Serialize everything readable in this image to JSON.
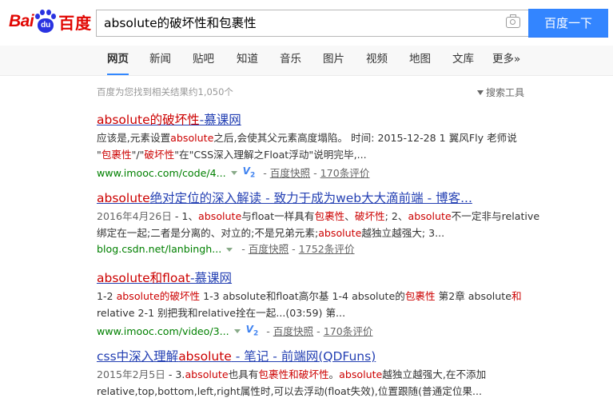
{
  "logo": {
    "left": "Bai",
    "mid": "du",
    "right": "百度"
  },
  "search": {
    "query": "absolute的破坏性和包裹性",
    "button": "百度一下"
  },
  "tabs": [
    "网页",
    "新闻",
    "贴吧",
    "知道",
    "音乐",
    "图片",
    "视频",
    "地图",
    "文库",
    "更多»"
  ],
  "stats": {
    "count": "百度为您找到相关结果约1,050个",
    "tools": "搜索工具"
  },
  "results": [
    {
      "title_parts": [
        "absolute的破坏性",
        "-慕课网"
      ],
      "abstract_lines": [
        [
          "应该是,元素设置",
          "absolute",
          "之后,会使其父元素高度塌陷。 时间: 2015-12-28 1 翼风Fly 老师说"
        ],
        [
          "\"",
          "包裹性",
          "\"/\"",
          "破坏性",
          "\"在\"CSS深入理解之Float浮动\"说明完毕,..."
        ]
      ],
      "url": "www.imooc.com/code/4...",
      "v_label": "V",
      "v_sub": "2",
      "snapshot": "百度快照",
      "reviews": "170条评价"
    },
    {
      "title_parts": [
        "absolute",
        "绝对定位的深入解读 - 致力于成为web大大滴前端 - 博客..."
      ],
      "date": "2016年4月26日",
      "abstract_lines": [
        [
          " - 1、",
          "absolute",
          "与float一样具有",
          "包裹性",
          "、",
          "破坏性",
          "; 2、",
          "absolute",
          "不一定非与relative"
        ],
        [
          "绑定在一起;二者是分离的、对立的;不是兄弟元素;",
          "absolute",
          "越独立越强大; 3..."
        ]
      ],
      "url": "blog.csdn.net/lanbingh...",
      "snapshot": "百度快照",
      "reviews": "1752条评价"
    },
    {
      "title_parts": [
        "absolute和float",
        "-慕课网"
      ],
      "abstract_lines": [
        [
          "1-2 ",
          "absolute的破坏性",
          " 1-3 absolute和float高尔基 1-4 absolute的",
          "包裹性",
          " 第2章 absolute",
          "和"
        ],
        [
          "relative 2-1 别把我和relative拴在一起...(03:59) 第..."
        ]
      ],
      "url": "www.imooc.com/video/3...",
      "v_label": "V",
      "v_sub": "2",
      "snapshot": "百度快照",
      "reviews": "170条评价"
    },
    {
      "title_parts": [
        "css中深入理解",
        "absolute",
        " - 笔记 - 前端网(QDFuns)"
      ],
      "date": "2015年2月5日",
      "abstract_lines": [
        [
          " - 3.",
          "absolute",
          "也具有",
          "包裹性和破坏性",
          "。",
          "absolute",
          "越独立越强大,在不添加"
        ],
        [
          "relative,top,bottom,left,right属性时,可以去浮动(float失效),位置跟随(普通定位果..."
        ]
      ]
    }
  ]
}
